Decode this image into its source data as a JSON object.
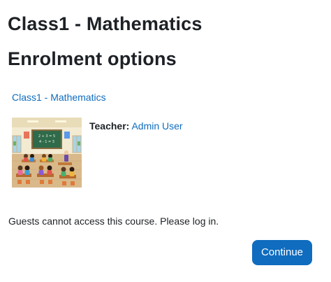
{
  "page": {
    "title": "Class1 - Mathematics",
    "section_title": "Enrolment options"
  },
  "course": {
    "link_text": "Class1 - Mathematics",
    "image_icon": "classroom-illustration",
    "image_board_text_line1": "2 + 3 = 5",
    "image_board_text_line2": "4 - 1 = 3",
    "teacher_label": "Teacher:",
    "teacher_name": "Admin User"
  },
  "message": "Guests cannot access this course. Please log in.",
  "actions": {
    "continue_label": "Continue"
  },
  "colors": {
    "link": "#0f6cbf",
    "primary_button": "#0f6cbf",
    "text": "#1d2125"
  }
}
